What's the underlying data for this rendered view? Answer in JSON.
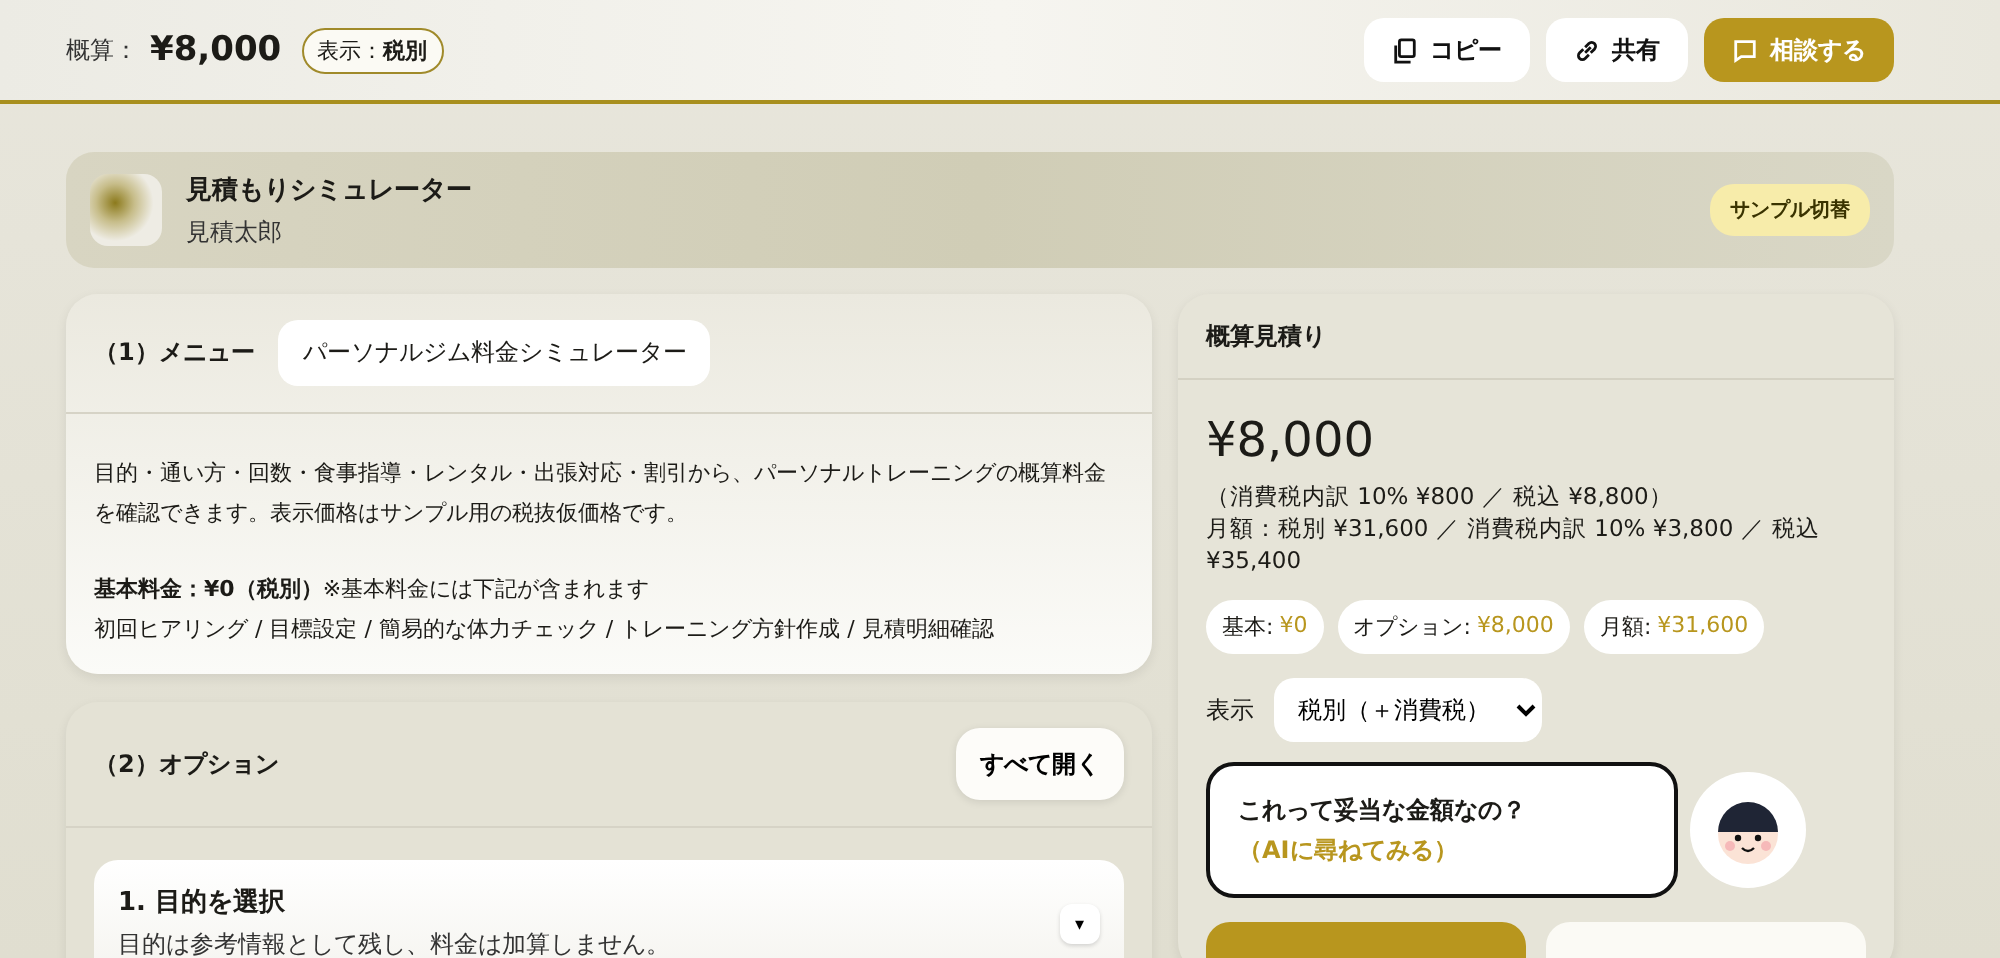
{
  "topbar": {
    "estimate_label": "概算：",
    "estimate_value": "¥8,000",
    "tax_badge": "表示：**税別**",
    "buttons": [
      {
        "label": "コピー",
        "kind": "copy"
      },
      {
        "label": "共有",
        "kind": "share"
      },
      {
        "label": "相談する",
        "kind": "consult"
      }
    ]
  },
  "profile": {
    "title": "見積もりシミュレーター",
    "name": "見積太郎",
    "switch_button": "サンプル切替"
  },
  "menu_section": {
    "heading": "（1）メニュー",
    "menu_name": "パーソナルジム料金シミュレーター",
    "description": "目的・通い方・回数・食事指導・レンタル・出張対応・割引から、パーソナルトレーニングの概算料金を確認できます。表示価格はサンプル用の税抜仮価格です。",
    "base_fee": "**基本料金：¥0（税別）**※基本料金には下記が含まれます",
    "includes": "初回ヒアリング / 目標設定 / 簡易的な体力チェック / トレーニング方針作成 / 見積明細確認"
  },
  "options_section": {
    "heading": "（2）オプション",
    "expand_all_button": "すべて開く",
    "items": [
      {
        "title": "1. 目的を選択",
        "note": "目的は参考情報として残し、料金は加算しません。",
        "toggle": "▾",
        "expanded": false
      }
    ]
  },
  "estimate_panel": {
    "title": "概算見積り",
    "total": "¥8,000",
    "tax_note": "（消費税内訳 10% ¥800 ／ 税込 ¥8,800）",
    "monthly_note": "月額：税別 ¥31,600 ／ 消費税内訳 10% ¥3,800 ／ 税込 ¥35,400",
    "chips": [
      {
        "label": "基本:",
        "value": "¥0"
      },
      {
        "label": "オプション:",
        "value": "¥8,000"
      },
      {
        "label": "月額:",
        "value": "¥31,600"
      }
    ],
    "display_label": "表示",
    "display_select": "税別（＋消費税）",
    "bubble_question": "これって妥当な金額なの？",
    "bubble_link": "（AIに尋ねてみる）"
  }
}
